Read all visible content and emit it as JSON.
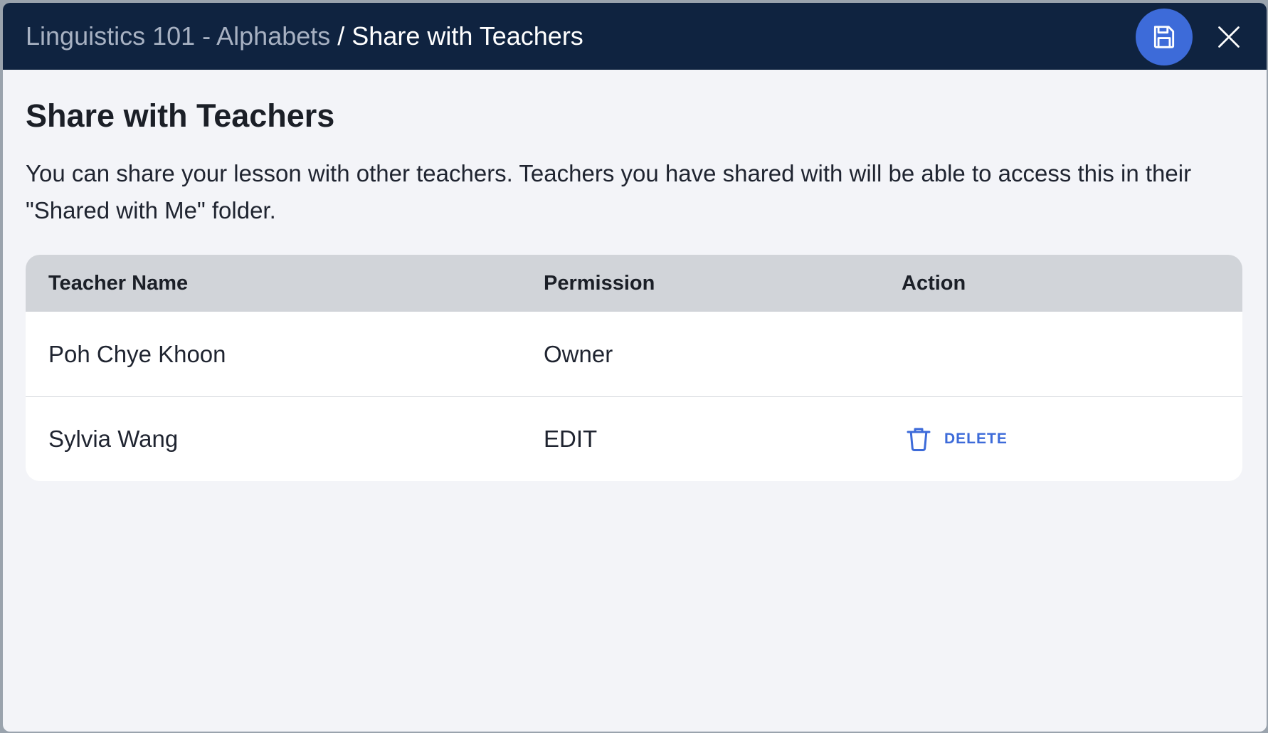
{
  "header": {
    "breadcrumb_parent": "Linguistics 101 - Alphabets",
    "breadcrumb_separator": "/",
    "breadcrumb_current": "Share with Teachers",
    "save_icon": "save-icon",
    "close_icon": "close-icon"
  },
  "main": {
    "title": "Share with Teachers",
    "description": "You can share your lesson with other teachers. Teachers you have shared with will be able to access this in their \"Shared with Me\" folder."
  },
  "table": {
    "columns": [
      "Teacher Name",
      "Permission",
      "Action"
    ],
    "rows": [
      {
        "name": "Poh Chye Khoon",
        "permission": "Owner",
        "action": ""
      },
      {
        "name": "Sylvia Wang",
        "permission": "EDIT",
        "action": "DELETE"
      }
    ]
  },
  "colors": {
    "header_bg": "#0f2340",
    "accent": "#3d6bd9",
    "page_bg": "#f3f4f8",
    "table_header_bg": "#d1d4d9"
  }
}
